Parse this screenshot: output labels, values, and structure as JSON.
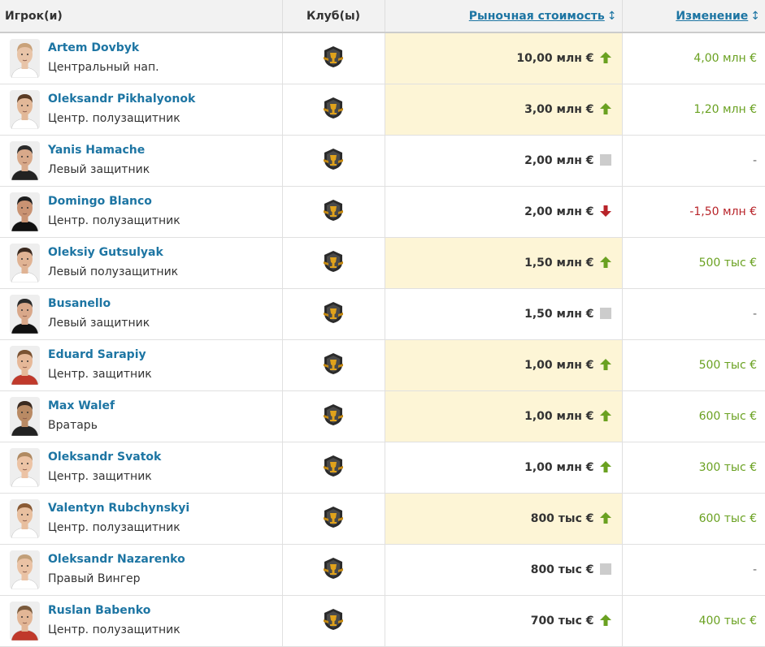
{
  "header": {
    "player": "Игрок(и)",
    "club": "Клуб(ы)",
    "market_value": "Рыночная стоимость",
    "change": "Изменение",
    "sort_arrows": "↕"
  },
  "colors": {
    "link": "#1d75a3",
    "up": "#6aa121",
    "down": "#b8242a",
    "highlight": "#fdf5d6",
    "neutral": "#cccccc"
  },
  "rows": [
    {
      "name": "Artem Dovbyk",
      "position": "Центральный нап.",
      "value": "10,00 млн €",
      "trend": "up",
      "change": "4,00 млн €",
      "highlight": true,
      "skin": "#e8c4a8",
      "hair": "#c9a27a",
      "jersey": "#ffffff"
    },
    {
      "name": "Oleksandr Pikhalyonok",
      "position": "Центр. полузащитник",
      "value": "3,00 млн €",
      "trend": "up",
      "change": "1,20 млн €",
      "highlight": true,
      "skin": "#e2b898",
      "hair": "#5a3b24",
      "jersey": "#ffffff"
    },
    {
      "name": "Yanis Hamache",
      "position": "Левый защитник",
      "value": "2,00 млн €",
      "trend": "none",
      "change": "-",
      "highlight": false,
      "skin": "#d8a98a",
      "hair": "#2b2b2b",
      "jersey": "#222222"
    },
    {
      "name": "Domingo Blanco",
      "position": "Центр. полузащитник",
      "value": "2,00 млн €",
      "trend": "down",
      "change": "-1,50 млн €",
      "highlight": false,
      "skin": "#c99373",
      "hair": "#1e1e1e",
      "jersey": "#111111"
    },
    {
      "name": "Oleksiy Gutsulyak",
      "position": "Левый полузащитник",
      "value": "1,50 млн €",
      "trend": "up",
      "change": "500 тыс €",
      "highlight": true,
      "skin": "#e0b394",
      "hair": "#3b2a20",
      "jersey": "#ffffff"
    },
    {
      "name": "Busanello",
      "position": "Левый защитник",
      "value": "1,50 млн €",
      "trend": "none",
      "change": "-",
      "highlight": false,
      "skin": "#d9a88a",
      "hair": "#2a2a2a",
      "jersey": "#111111"
    },
    {
      "name": "Eduard Sarapiy",
      "position": "Центр. защитник",
      "value": "1,00 млн €",
      "trend": "up",
      "change": "500 тыс €",
      "highlight": true,
      "skin": "#e6b898",
      "hair": "#7a5232",
      "jersey": "#c0392b"
    },
    {
      "name": "Max Walef",
      "position": "Вратарь",
      "value": "1,00 млн €",
      "trend": "up",
      "change": "600 тыс €",
      "highlight": true,
      "skin": "#b98a64",
      "hair": "#3a2a20",
      "jersey": "#222222"
    },
    {
      "name": "Oleksandr Svatok",
      "position": "Центр. защитник",
      "value": "1,00 млн €",
      "trend": "up",
      "change": "300 тыс €",
      "highlight": false,
      "skin": "#ecc3a5",
      "hair": "#b08a62",
      "jersey": "#ffffff"
    },
    {
      "name": "Valentyn Rubchynskyi",
      "position": "Центр. полузащитник",
      "value": "800 тыс €",
      "trend": "up",
      "change": "600 тыс €",
      "highlight": true,
      "skin": "#e8bf9f",
      "hair": "#8a5a34",
      "jersey": "#ffffff"
    },
    {
      "name": "Oleksandr Nazarenko",
      "position": "Правый Вингер",
      "value": "800 тыс €",
      "trend": "none",
      "change": "-",
      "highlight": false,
      "skin": "#eac2a4",
      "hair": "#c2a07a",
      "jersey": "#ffffff"
    },
    {
      "name": "Ruslan Babenko",
      "position": "Центр. полузащитник",
      "value": "700 тыс €",
      "trend": "up",
      "change": "400 тыс €",
      "highlight": false,
      "skin": "#e2b696",
      "hair": "#7a5a3c",
      "jersey": "#c0392b"
    }
  ]
}
